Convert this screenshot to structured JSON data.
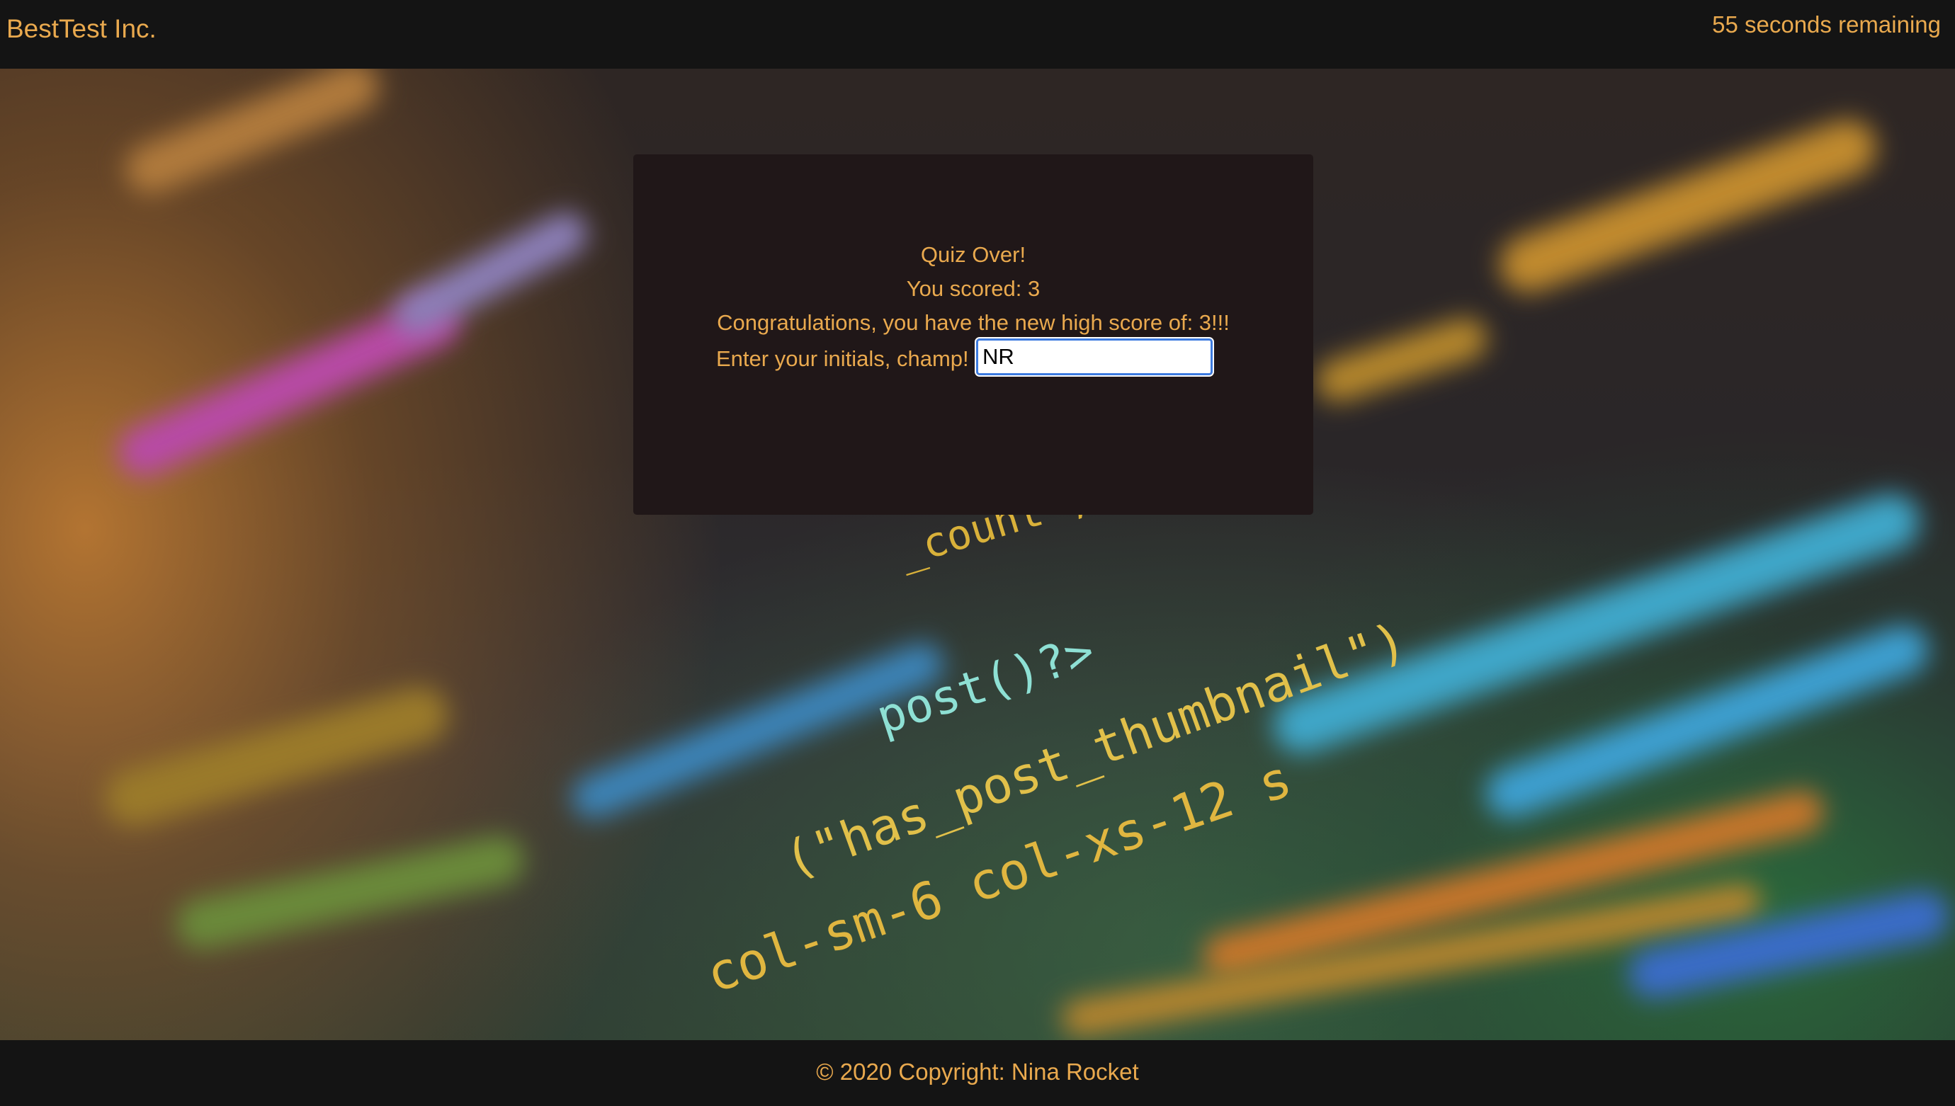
{
  "navbar": {
    "brand": "BestTest Inc.",
    "timer": "55 seconds remaining"
  },
  "background": {
    "code_fragments": [
      "_count',",
      "post()?>",
      "(\"has_post_thumbnail\")",
      "col-sm-6 col-xs-12 s"
    ]
  },
  "quiz": {
    "status": "Quiz Over!",
    "score_text": "You scored: 3",
    "high_score_text": "Congratulations, you have the new high score of: 3!!!",
    "initials_label": "Enter your initials, champ!",
    "initials_value": "NR"
  },
  "footer": {
    "copyright": "© 2020 Copyright: Nina Rocket"
  },
  "colors": {
    "accent": "#e9a94e",
    "bar_background": "#141414",
    "card_background": "#201718",
    "input_focus_border": "#3d7be0"
  }
}
